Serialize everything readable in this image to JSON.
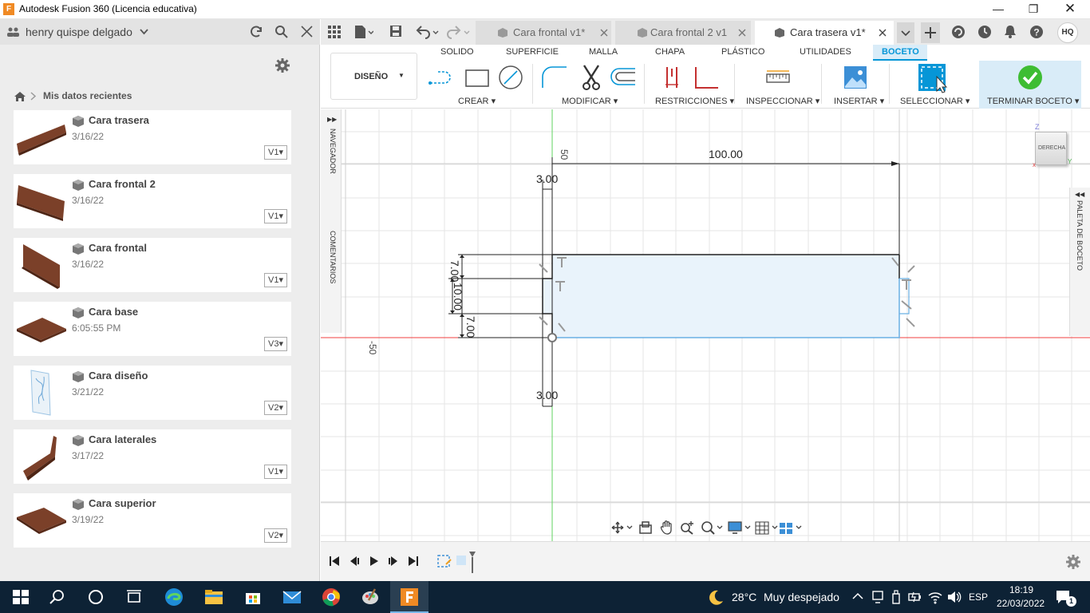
{
  "window": {
    "title": "Autodesk Fusion 360 (Licencia educativa)",
    "app_icon": "F"
  },
  "data_panel": {
    "user": "henry quispe delgado",
    "breadcrumb": "Mis datos recientes",
    "items": [
      {
        "name": "Cara trasera",
        "date": "3/16/22",
        "version": "V1"
      },
      {
        "name": "Cara frontal 2",
        "date": "3/16/22",
        "version": "V1"
      },
      {
        "name": "Cara frontal",
        "date": "3/16/22",
        "version": "V1"
      },
      {
        "name": "Cara base",
        "date": "6:05:55 PM",
        "version": "V3"
      },
      {
        "name": "Cara diseño",
        "date": "3/21/22",
        "version": "V2"
      },
      {
        "name": "Cara laterales",
        "date": "3/17/22",
        "version": "V1"
      },
      {
        "name": "Cara superior",
        "date": "3/19/22",
        "version": "V2"
      }
    ]
  },
  "tabs": [
    {
      "label": "Cara frontal v1*"
    },
    {
      "label": "Cara frontal 2 v1"
    },
    {
      "label": "Cara trasera v1*"
    }
  ],
  "user_initials": "HQ",
  "toolbar": {
    "workspace": "DISEÑO",
    "menu_tabs": [
      "SOLIDO",
      "SUPERFICIE",
      "MALLA",
      "CHAPA",
      "PLÁSTICO",
      "UTILIDADES",
      "BOCETO"
    ],
    "groups": [
      "CREAR",
      "MODIFICAR",
      "RESTRICCIONES",
      "INSPECCIONAR",
      "INSERTAR",
      "SELECCIONAR",
      "TERMINAR BOCETO"
    ]
  },
  "canvas": {
    "navigator_label": "NAVEGADOR",
    "comments_label": "COMENTARIOS",
    "palette_label": "PALETA DE BOCETO",
    "viewcube_face": "DERECHA",
    "axis_label_top": "50",
    "axis_label_left": "-50",
    "dimensions": {
      "width": "100.00",
      "thickness_top": "3.00",
      "thickness_bottom": "3.00",
      "h1": "7.00",
      "h2": "10.00",
      "h3": "7.00"
    }
  },
  "taskbar": {
    "weather_temp": "28°C",
    "weather_text": "Muy despejado",
    "language": "ESP",
    "time": "18:19",
    "date": "22/03/2022",
    "notifications": "1"
  },
  "colors": {
    "accent": "#0696d7",
    "sketch_fill": "#e9f3fb",
    "sketch_line": "#6ab0e4",
    "taskbar": "#0d2235",
    "wood": "#6e3a24"
  }
}
